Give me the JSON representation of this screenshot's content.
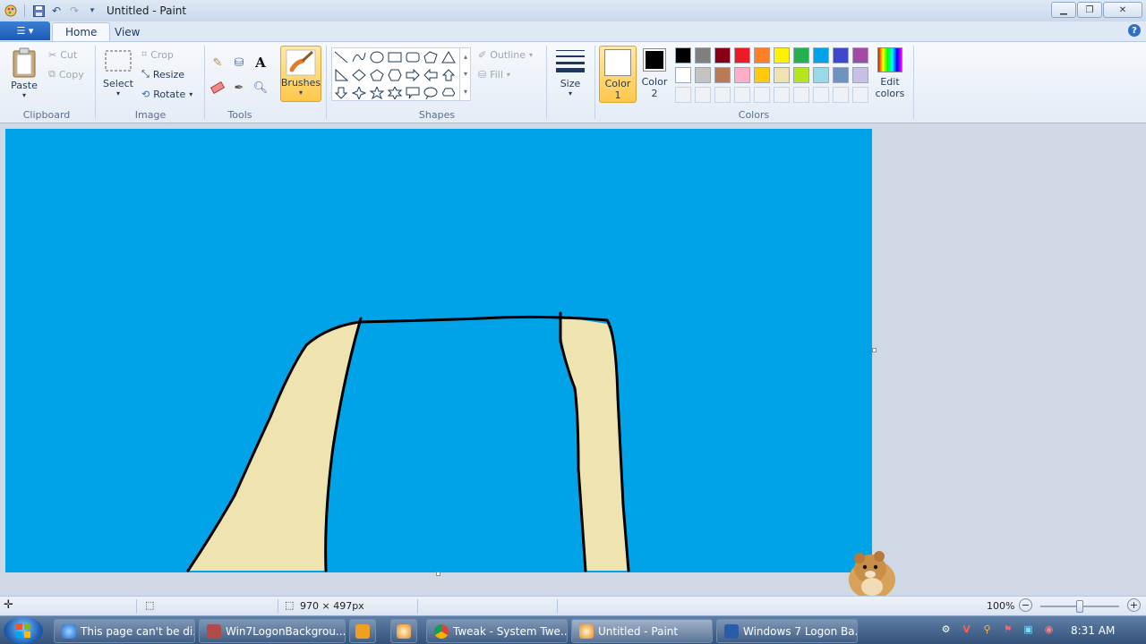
{
  "window": {
    "title": "Untitled - Paint"
  },
  "tabs": [
    {
      "label": "Home"
    },
    {
      "label": "View"
    }
  ],
  "clipboard": {
    "group_label": "Clipboard",
    "paste": "Paste",
    "cut": "Cut",
    "copy": "Copy"
  },
  "image": {
    "group_label": "Image",
    "select": "Select",
    "crop": "Crop",
    "resize": "Resize",
    "rotate": "Rotate"
  },
  "tools": {
    "group_label": "Tools",
    "text_glyph": "A"
  },
  "brushes": {
    "label": "Brushes"
  },
  "shapes": {
    "group_label": "Shapes",
    "outline": "Outline",
    "fill": "Fill"
  },
  "size": {
    "label": "Size"
  },
  "colors": {
    "group_label": "Colors",
    "color1_label": "Color",
    "color1_num": "1",
    "color2_label": "Color",
    "color2_num": "2",
    "edit_label": "Edit",
    "edit_label2": "colors",
    "color1_value": "#ffffff",
    "color2_value": "#000000",
    "palette_row1": [
      "#000000",
      "#7f7f7f",
      "#880015",
      "#ed1c24",
      "#ff7f27",
      "#fff200",
      "#22b14c",
      "#00a2e8",
      "#3f48cc",
      "#a349a4"
    ],
    "palette_row2": [
      "#ffffff",
      "#c3c3c3",
      "#b97a57",
      "#ffaec9",
      "#ffc90e",
      "#efe4b0",
      "#b5e61d",
      "#99d9ea",
      "#7092be",
      "#c8bfe7"
    ]
  },
  "canvas": {
    "background": "#00a2e8",
    "fill_color": "#efe4b0",
    "stroke_color": "#000000"
  },
  "status": {
    "dimensions": "970 × 497px",
    "zoom": "100%"
  },
  "taskbar": {
    "items": [
      {
        "label": "This page can't be di..."
      },
      {
        "label": "Win7LogonBackgrou..."
      },
      {
        "label": ""
      },
      {
        "label": ""
      },
      {
        "label": "Tweak - System Twe..."
      },
      {
        "label": "Untitled - Paint"
      },
      {
        "label": "Windows 7 Logon Ba..."
      }
    ],
    "clock": "8:31 AM"
  }
}
